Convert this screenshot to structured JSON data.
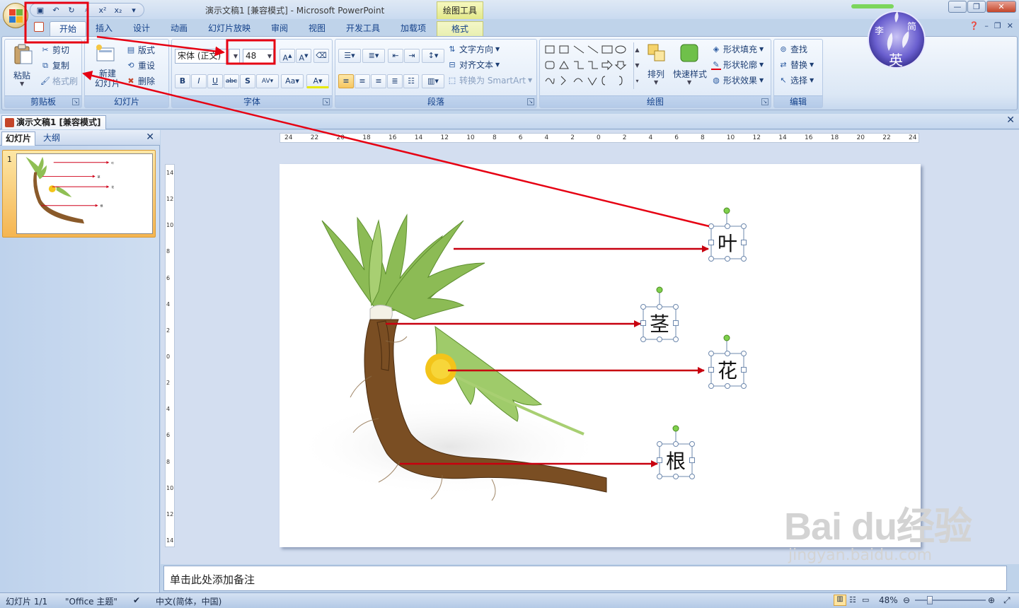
{
  "window": {
    "title": "演示文稿1 [兼容模式] - Microsoft PowerPoint",
    "context_tab_title": "绘图工具"
  },
  "ribbon_tabs": [
    "开始",
    "插入",
    "设计",
    "动画",
    "幻灯片放映",
    "审阅",
    "视图",
    "开发工具",
    "加载项",
    "格式"
  ],
  "groups": {
    "clipboard": {
      "label": "剪贴板",
      "paste": "粘贴",
      "cut": "剪切",
      "copy": "复制",
      "format_painter": "格式刷"
    },
    "slides": {
      "label": "幻灯片",
      "new_slide": "新建\n幻灯片",
      "layout": "版式",
      "reset": "重设",
      "delete": "删除"
    },
    "font": {
      "label": "字体",
      "font_name": "宋体 (正文)",
      "font_size": "48"
    },
    "paragraph": {
      "label": "段落",
      "text_direction": "文字方向",
      "align_text": "对齐文本",
      "smartart": "转换为 SmartArt"
    },
    "drawing": {
      "label": "绘图",
      "arrange": "排列",
      "quick_styles": "快速样式",
      "shape_fill": "形状填充",
      "shape_outline": "形状轮廓",
      "shape_effects": "形状效果"
    },
    "editing": {
      "label": "编辑",
      "find": "查找",
      "replace": "替换",
      "select": "选择"
    }
  },
  "document_tab": "演示文稿1 [兼容模式]",
  "pane_tabs": {
    "slides": "幻灯片",
    "outline": "大纲"
  },
  "thumbnail": {
    "number": "1"
  },
  "ruler": {
    "h_ticks": [
      "24",
      "22",
      "20",
      "18",
      "16",
      "14",
      "12",
      "10",
      "8",
      "6",
      "4",
      "2",
      "0",
      "2",
      "4",
      "6",
      "8",
      "10",
      "12",
      "14",
      "16",
      "18",
      "20",
      "22",
      "24"
    ],
    "v_ticks": [
      "14",
      "12",
      "10",
      "8",
      "6",
      "4",
      "2",
      "0",
      "2",
      "4",
      "6",
      "8",
      "10",
      "12",
      "14"
    ]
  },
  "slide": {
    "labels": [
      {
        "text": "叶",
        "name": "leaf"
      },
      {
        "text": "茎",
        "name": "stem"
      },
      {
        "text": "花",
        "name": "flower"
      },
      {
        "text": "根",
        "name": "root"
      }
    ]
  },
  "notes": {
    "placeholder": "单击此处添加备注"
  },
  "status": {
    "slide_info": "幻灯片 1/1",
    "theme": "\"Office 主题\"",
    "language": "中文(简体，中国)",
    "zoom": "48%"
  },
  "watermark": {
    "big": "Bai du经验",
    "small": "jingyan.baidu.com",
    "avatar": [
      "李",
      "简",
      "英"
    ]
  },
  "colors": {
    "accent": "#15428b",
    "highlight": "#e60012",
    "active_button": "#f6c660"
  }
}
